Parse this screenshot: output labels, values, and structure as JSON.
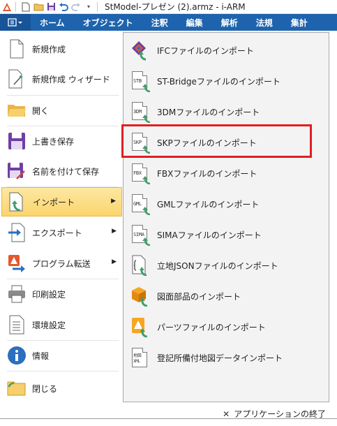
{
  "titlebar": {
    "title": "StModel-プレゼン (2).armz - i-ARM"
  },
  "menubar": {
    "tabs": [
      "ホーム",
      "オブジェクト",
      "注釈",
      "編集",
      "解析",
      "法規",
      "集計"
    ]
  },
  "left_menu": {
    "new": "新規作成",
    "new_wizard": "新規作成 ウィザード",
    "open": "開く",
    "save": "上書き保存",
    "save_as": "名前を付けて保存",
    "import": "インポート",
    "export": "エクスポート",
    "program_transfer": "プログラム転送",
    "print_settings": "印刷設定",
    "env_settings": "環境設定",
    "info": "情報",
    "close": "閉じる"
  },
  "import_menu": {
    "items": [
      {
        "label": "IFCファイルのインポート",
        "icon": "ifc-icon"
      },
      {
        "label": "ST-Bridgeファイルのインポート",
        "icon": "stb-icon",
        "tag": "STB"
      },
      {
        "label": "3DMファイルのインポート",
        "icon": "3dm-icon",
        "tag": "3DM"
      },
      {
        "label": "SKPファイルのインポート",
        "icon": "skp-icon",
        "tag": "SKP"
      },
      {
        "label": "FBXファイルのインポート",
        "icon": "fbx-icon",
        "tag": "FBX"
      },
      {
        "label": "GMLファイルのインポート",
        "icon": "gml-icon",
        "tag": "GML"
      },
      {
        "label": "SIMAファイルのインポート",
        "icon": "sima-icon",
        "tag": "SIMA"
      },
      {
        "label": "立地JSONファイルのインポート",
        "icon": "json-icon"
      },
      {
        "label": "図面部品のインポート",
        "icon": "parts-box-icon"
      },
      {
        "label": "パーツファイルのインポート",
        "icon": "parts-file-icon"
      },
      {
        "label": "登記所備付地図データインポート",
        "icon": "xml-map-icon",
        "tag": "地図\nXML"
      }
    ]
  },
  "bottom": {
    "exit_label": "アプリケーションの終了"
  },
  "colors": {
    "ribbon": "#1e63ad",
    "active_item": "#fbd56d",
    "highlight": "#e01f22",
    "arrow_green": "#3f9e6a"
  }
}
